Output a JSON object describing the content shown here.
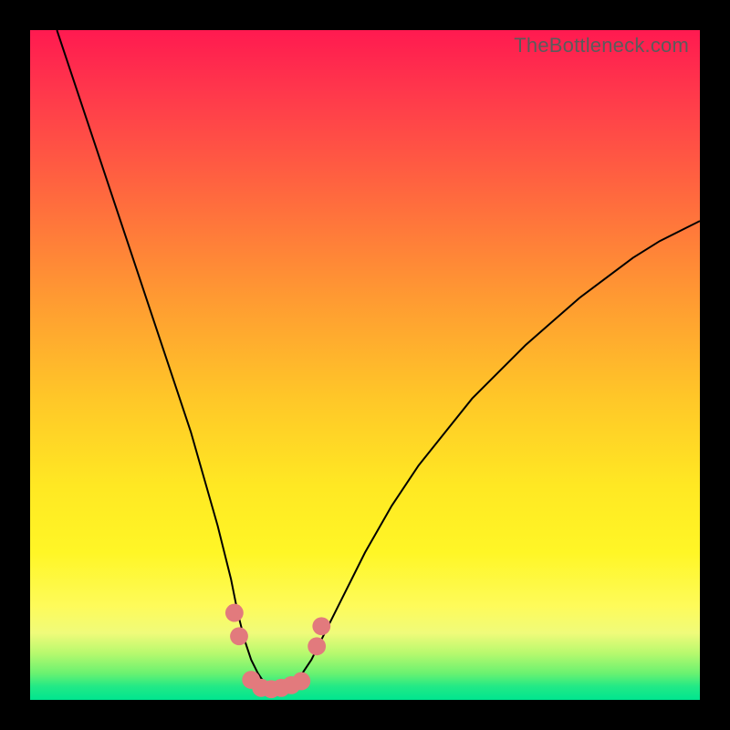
{
  "brand": "TheBottleneck.com",
  "chart_data": {
    "type": "line",
    "title": "",
    "xlabel": "",
    "ylabel": "",
    "xlim": [
      0,
      100
    ],
    "ylim": [
      0,
      100
    ],
    "series": [
      {
        "name": "bottleneck-curve",
        "x": [
          4,
          6,
          8,
          10,
          12,
          14,
          16,
          18,
          20,
          22,
          24,
          26,
          28,
          30,
          31,
          32,
          33,
          34,
          35,
          36,
          37,
          38,
          39,
          40,
          42,
          44,
          46,
          48,
          50,
          54,
          58,
          62,
          66,
          70,
          74,
          78,
          82,
          86,
          90,
          94,
          98,
          100
        ],
        "y": [
          100,
          94,
          88,
          82,
          76,
          70,
          64,
          58,
          52,
          46,
          40,
          33,
          26,
          18,
          13,
          9,
          6,
          4,
          2.5,
          1.8,
          1.5,
          1.6,
          2,
          3,
          6,
          10,
          14,
          18,
          22,
          29,
          35,
          40,
          45,
          49,
          53,
          56.5,
          60,
          63,
          66,
          68.5,
          70.5,
          71.5
        ]
      }
    ],
    "markers": {
      "name": "sample-points",
      "color": "#e27a7d",
      "points": [
        {
          "x": 30.5,
          "y": 13
        },
        {
          "x": 31.2,
          "y": 9.5
        },
        {
          "x": 33.0,
          "y": 3.0
        },
        {
          "x": 34.5,
          "y": 1.8
        },
        {
          "x": 36.0,
          "y": 1.6
        },
        {
          "x": 37.5,
          "y": 1.8
        },
        {
          "x": 39.0,
          "y": 2.2
        },
        {
          "x": 40.5,
          "y": 2.8
        },
        {
          "x": 42.8,
          "y": 8.0
        },
        {
          "x": 43.5,
          "y": 11.0
        }
      ]
    }
  }
}
